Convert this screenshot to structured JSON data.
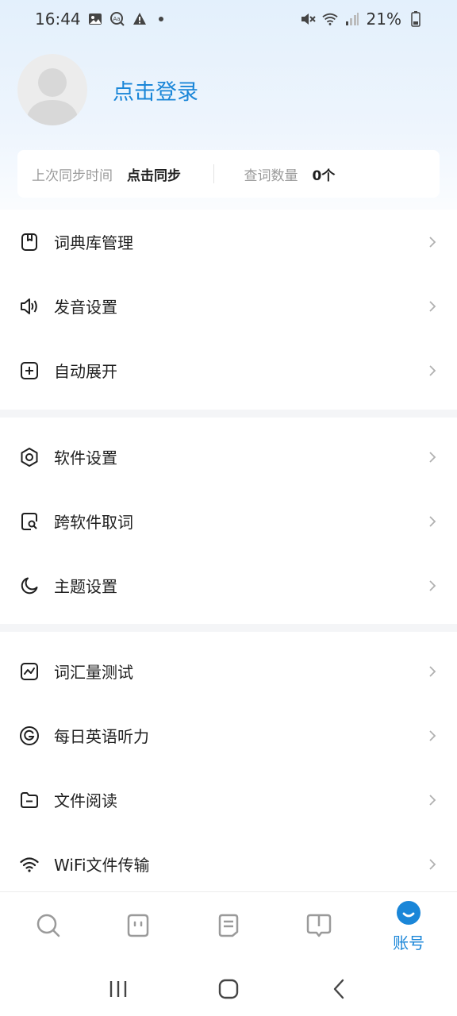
{
  "status_bar": {
    "time": "16:44",
    "battery": "21%",
    "icons": [
      "gallery-icon",
      "text-recognition-icon",
      "warning-icon",
      "dot-icon",
      "mute-icon",
      "wifi-icon",
      "signal-icon",
      "battery-icon"
    ]
  },
  "profile": {
    "login_label": "点击登录"
  },
  "sync": {
    "last_sync_label": "上次同步时间",
    "sync_action": "点击同步",
    "word_count_label": "查词数量",
    "word_count_value": "0个"
  },
  "menu_groups": [
    {
      "items": [
        {
          "label": "词典库管理",
          "icon": "dictionary-icon"
        },
        {
          "label": "发音设置",
          "icon": "speaker-icon"
        },
        {
          "label": "自动展开",
          "icon": "plus-square-icon"
        }
      ]
    },
    {
      "items": [
        {
          "label": "软件设置",
          "icon": "settings-hexagon-icon"
        },
        {
          "label": "跨软件取词",
          "icon": "search-document-icon"
        },
        {
          "label": "主题设置",
          "icon": "moon-icon"
        }
      ]
    },
    {
      "items": [
        {
          "label": "词汇量测试",
          "icon": "chart-square-icon"
        },
        {
          "label": "每日英语听力",
          "icon": "listening-icon"
        },
        {
          "label": "文件阅读",
          "icon": "folder-icon"
        },
        {
          "label": "WiFi文件传输",
          "icon": "wifi-icon"
        }
      ]
    }
  ],
  "tabbar": {
    "tabs": [
      {
        "icon": "search-icon"
      },
      {
        "icon": "chat-face-icon"
      },
      {
        "icon": "notes-icon"
      },
      {
        "icon": "book-icon"
      },
      {
        "icon": "account-icon",
        "label": "账号",
        "active": true
      }
    ]
  },
  "colors": {
    "accent": "#1a86d8",
    "text": "#1f1f1f",
    "muted": "#9a9a9a"
  }
}
